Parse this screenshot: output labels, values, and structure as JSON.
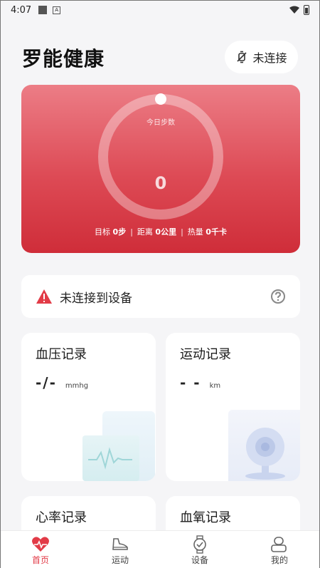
{
  "status_bar": {
    "time": "4:07",
    "notif_a": "A"
  },
  "header": {
    "title": "罗能健康",
    "connect_label": "未连接"
  },
  "steps_card": {
    "label": "今日步数",
    "value": "0",
    "stats": {
      "target_label": "目标",
      "target_value": "0步",
      "distance_label": "距离",
      "distance_value": "0公里",
      "calorie_label": "热量",
      "calorie_value": "0千卡"
    },
    "colors": {
      "top": "#ec7d86",
      "bottom": "#cf2d39"
    }
  },
  "warning": {
    "text": "未连接到设备",
    "icon": "warning-icon",
    "help_icon": "help-icon"
  },
  "cards": {
    "blood_pressure": {
      "title": "血压记录",
      "value": "-/-",
      "unit": "mmhg"
    },
    "sport": {
      "title": "运动记录",
      "value": "- -",
      "unit": "km"
    },
    "heart_rate": {
      "title": "心率记录"
    },
    "blood_oxygen": {
      "title": "血氧记录"
    }
  },
  "tabbar": {
    "accent": "#e23b47",
    "items": [
      {
        "label": "首页",
        "icon": "heart-icon",
        "active": true
      },
      {
        "label": "运动",
        "icon": "shoe-icon",
        "active": false
      },
      {
        "label": "设备",
        "icon": "watch-icon",
        "active": false
      },
      {
        "label": "我的",
        "icon": "profile-icon",
        "active": false
      }
    ]
  }
}
